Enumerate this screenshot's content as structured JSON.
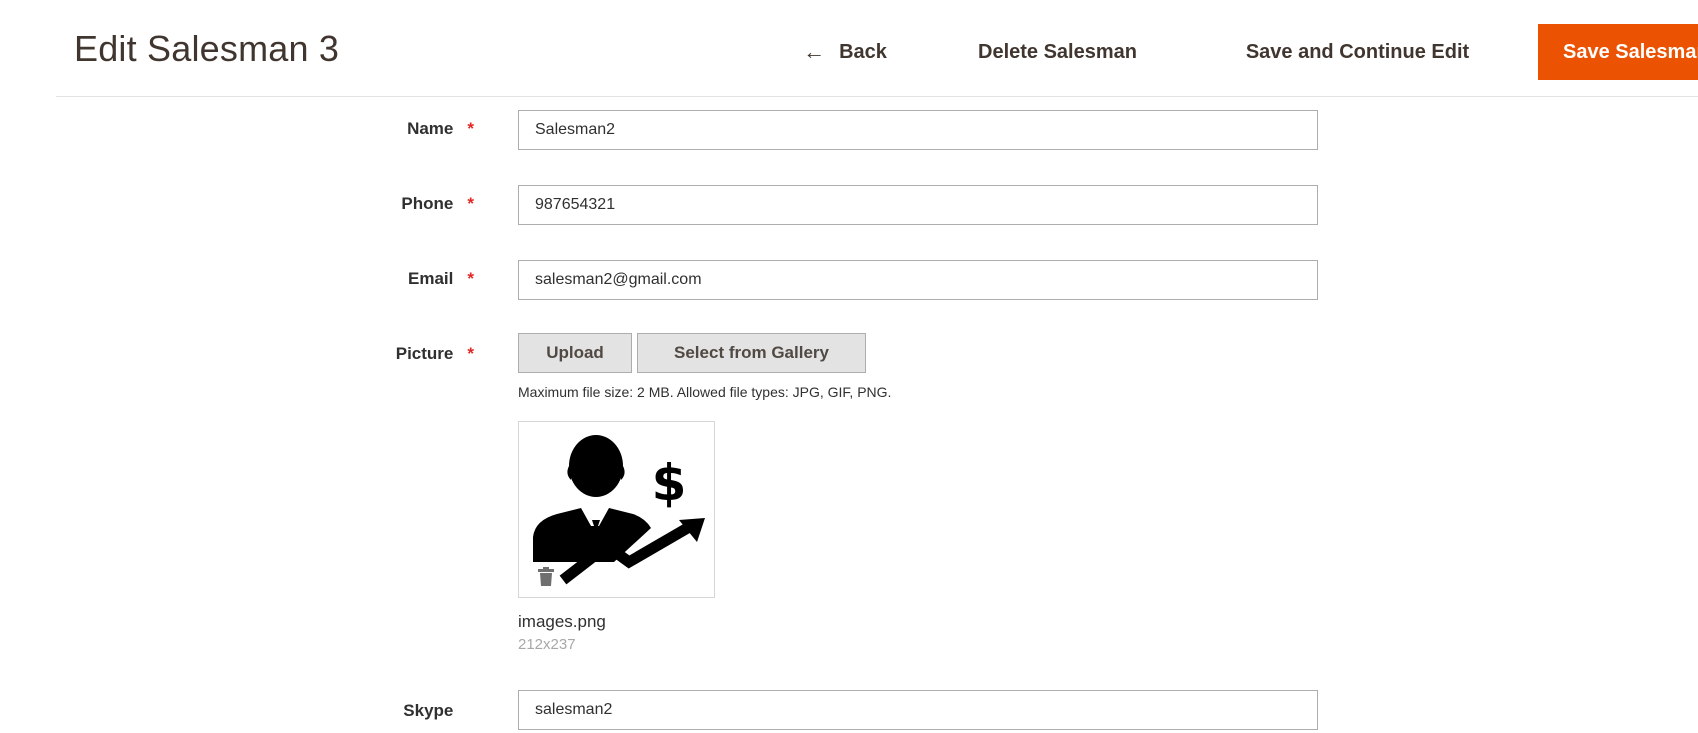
{
  "header": {
    "title": "Edit Salesman 3",
    "back_label": "Back",
    "delete_label": "Delete Salesman",
    "save_continue_label": "Save and Continue Edit",
    "save_label": "Save Salesman"
  },
  "form": {
    "name": {
      "label": "Name",
      "value": "Salesman2",
      "required": true
    },
    "phone": {
      "label": "Phone",
      "value": "987654321",
      "required": true
    },
    "email": {
      "label": "Email",
      "value": "salesman2@gmail.com",
      "required": true
    },
    "picture": {
      "label": "Picture",
      "required": true,
      "upload_label": "Upload",
      "gallery_label": "Select from Gallery",
      "note": "Maximum file size: 2 MB. Allowed file types: JPG, GIF, PNG.",
      "file_name": "images.png",
      "file_dims": "212x237"
    },
    "skype": {
      "label": "Skype",
      "value": "salesman2",
      "required": false
    },
    "required_marker": "*"
  },
  "colors": {
    "primary_button": "#eb5202",
    "required": "#e22626",
    "secondary_button": "#e3e3e3"
  },
  "icons": {
    "back": "arrow-left-icon",
    "delete_image": "trash-icon",
    "preview": "salesman-growth-icon"
  }
}
